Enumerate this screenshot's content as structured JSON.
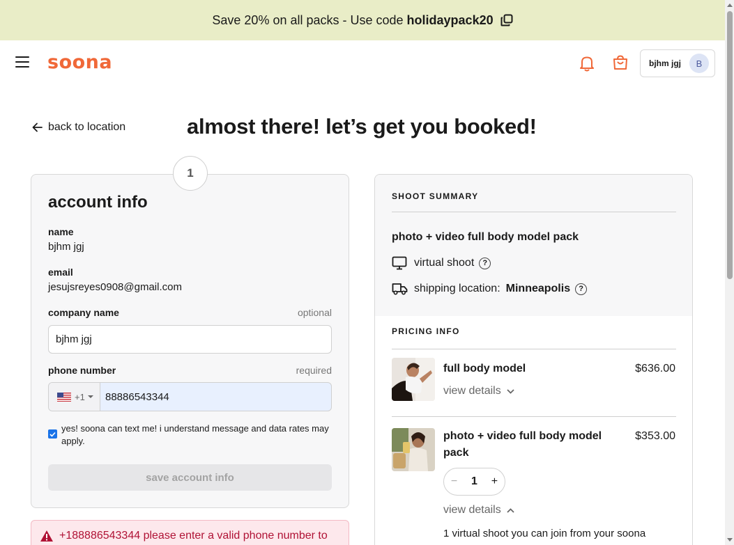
{
  "banner": {
    "text": "Save 20% on all packs - Use code",
    "code": "holidaypack20",
    "icon": "copy-icon"
  },
  "header": {
    "logo": "soona",
    "user_name": "bjhm jgj",
    "avatar_initial": "B",
    "icons": [
      "hamburger-icon",
      "bell-icon",
      "shopping-bag-icon"
    ]
  },
  "nav": {
    "back_label": "back to location"
  },
  "page": {
    "title": "almost there! let’s get you booked!"
  },
  "account": {
    "step": "1",
    "title": "account info",
    "name_label": "name",
    "name_value": "bjhm jgj",
    "email_label": "email",
    "email_value": "jesujsreyes0908@gmail.com",
    "company_label": "company name",
    "company_hint": "optional",
    "company_value": "bjhm jgj",
    "phone_label": "phone number",
    "phone_hint": "required",
    "country_code": "+1",
    "phone_value": "88886543344",
    "consent_text": "yes! soona can text me! i understand message and data rates may apply.",
    "consent_checked": true,
    "save_label": "save account info"
  },
  "error": {
    "text": "+188886543344 please enter a valid phone number to"
  },
  "summary": {
    "header": "SHOOT SUMMARY",
    "pack_name": "photo + video full body model pack",
    "shoot_type": "virtual shoot",
    "shipping_label": "shipping location:",
    "shipping_city": "Minneapolis"
  },
  "pricing": {
    "header": "PRICING INFO",
    "items": [
      {
        "name": "full body model",
        "price": "$636.00",
        "details_label": "view details"
      },
      {
        "name": "photo + video full body model pack",
        "price": "$353.00",
        "quantity": "1",
        "details_label": "view details",
        "description": "1 virtual shoot you can join from your soona"
      }
    ]
  },
  "colors": {
    "brand": "#f06838",
    "banner_bg": "#e9edc7",
    "error": "#b01235",
    "checkbox": "#1a73e8"
  }
}
